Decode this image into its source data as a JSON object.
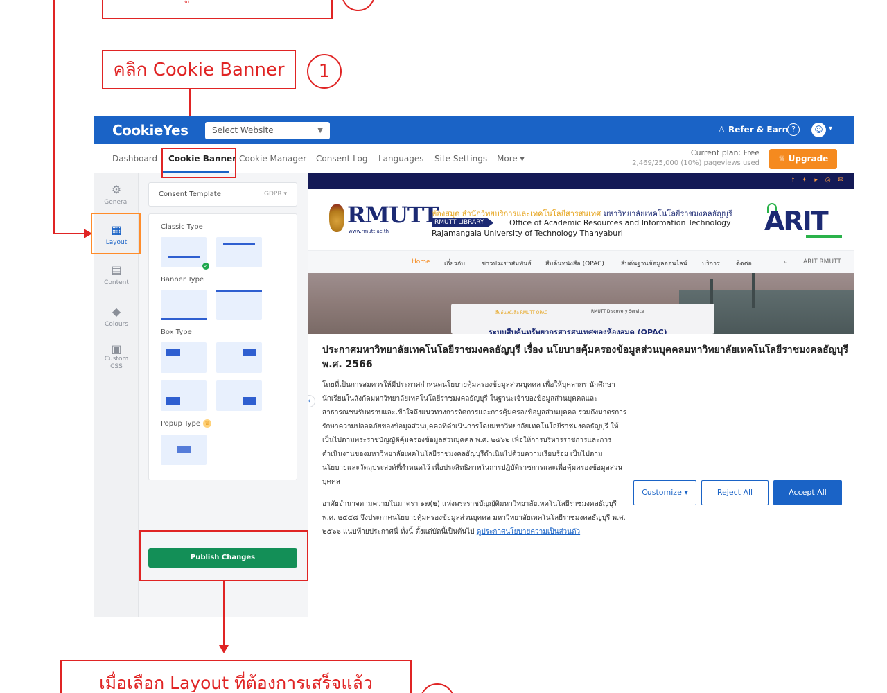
{
  "annotations": {
    "top_clipped": "เลือกรูปแบบที่ต้องการ",
    "step1_text": "คลิก Cookie Banner",
    "step1_number": "1",
    "bottom_text": "เมื่อเลือก Layout ที่ต้องการเสร็จแล้ว"
  },
  "topbar": {
    "logo": "CookieYes",
    "site_select": "Select Website",
    "refer": "Refer & Earn",
    "help": "?",
    "avatar": "☺"
  },
  "nav": {
    "items": [
      "Dashboard",
      "Cookie Banner",
      "Cookie Manager",
      "Consent Log",
      "Languages",
      "Site Settings",
      "More ▾"
    ],
    "plan": "Current plan: Free",
    "pageviews": "2,469/25,000 (10%) pageviews used",
    "upgrade": "Upgrade"
  },
  "sidebar": {
    "items": [
      {
        "label": "General",
        "icon": "gear-icon"
      },
      {
        "label": "Layout",
        "icon": "grid-icon"
      },
      {
        "label": "Content",
        "icon": "document-icon"
      },
      {
        "label": "Colours",
        "icon": "paint-bucket-icon"
      },
      {
        "label": "Custom CSS",
        "icon": "css-icon"
      }
    ],
    "active": "Layout"
  },
  "panel": {
    "template_label": "Consent Template",
    "template_value": "GDPR",
    "classic": "Classic Type",
    "banner": "Banner Type",
    "box": "Box Type",
    "popup": "Popup Type",
    "publish": "Publish Changes"
  },
  "preview": {
    "social": "f ✦ ▸ ◎ ✉",
    "brand": "RMUTT",
    "brand_sub": "www.rmutt.ac.th",
    "th_line_orange": "ห้องสมุด สำนักวิทยบริการและเทคโนโลยีสารสนเทศ",
    "th_line_blue": "มหาวิทยาลัยเทคโนโลยีราชมงคลธัญบุรี",
    "library_tag": "RMUTT LIBRARY",
    "office": "Office of Academic Resources and Information Technology",
    "university": "Rajamangala University of Technology Thanyaburi",
    "arit": "ARIT",
    "menu": [
      "Home",
      "เกี่ยวกับ",
      "ข่าวประชาสัมพันธ์",
      "สืบค้นหนังสือ (OPAC)",
      "สืบค้นฐานข้อมูลออนไลน์",
      "บริการ",
      "ติดต่อ"
    ],
    "menu_right": "ARIT RMUTT",
    "hero_tab1": "สืบค้นหนังสือ RMUTT OPAC",
    "hero_tab2": "RMUTT Discovery Service",
    "hero_title": "ระบบสืบค้นทรัพยากรสารสนเทศของห้องสมุด (OPAC)"
  },
  "banner": {
    "title": "ประกาศมหาวิทยาลัยเทคโนโลยีราชมงคลธัญบุรี เรื่อง นโยบายคุ้มครองข้อมูลส่วนบุคคลมหาวิทยาลัยเทคโนโลยีราชมงคลธัญบุรี พ.ศ. 2566",
    "para1": "โดยที่เป็นการสมควรให้มีประกาศกำหนดนโยบายคุ้มครองข้อมูลส่วนบุคคล เพื่อให้บุคลากร นักศึกษา นักเรียนในสังกัดมหาวิทยาลัยเทคโนโลยีราชมงคลธัญบุรี ในฐานะเจ้าของข้อมูลส่วนบุคคลและสาธารณชนรับทราบและเข้าใจถึงแนวทางการจัดการและการคุ้มครองข้อมูลส่วนบุคคล รวมถึงมาตรการรักษาความปลอดภัยของข้อมูลส่วนบุคคลที่ดำเนินการโดยมหาวิทยาลัยเทคโนโลยีราชมงคลธัญบุรี ให้เป็นไปตามพระราชบัญญัติคุ้มครองข้อมูลส่วนบุคคล พ.ศ. ๒๕๖๒ เพื่อให้การบริหารราชการและการดำเนินงานของมหาวิทยาลัยเทคโนโลยีราชมงคลธัญบุรีดำเนินไปด้วยความเรียบร้อย เป็นไปตามนโยบายและวัตถุประสงค์ที่กำหนดไว้ เพื่อประสิทธิภาพในการปฏิบัติราชการและเพื่อคุ้มครองข้อมูลส่วนบุคคล",
    "para2": "อาศัยอำนาจตามความในมาตรา ๑๗(๒) แห่งพระราชบัญญัติมหาวิทยาลัยเทคโนโลยีราชมงคลธัญบุรี พ.ศ. ๒๕๔๘ จึงประกาศนโยบายคุ้มครองข้อมูลส่วนบุคคล มหาวิทยาลัยเทคโนโลยีราชมงคลธัญบุรี พ.ศ. ๒๕๖๖ แนบท้ายประกาศนี้ ทั้งนี้ ตั้งแต่บัดนี้เป็นต้นไป",
    "link": "ดูประกาศนโยบายความเป็นส่วนตัว",
    "customize": "Customize ▾",
    "reject": "Reject All",
    "accept": "Accept All"
  },
  "colors": {
    "brand_blue": "#1a63c6",
    "annotation_red": "#e02424",
    "publish_green": "#138f57",
    "upgrade_orange": "#f58a1f"
  }
}
